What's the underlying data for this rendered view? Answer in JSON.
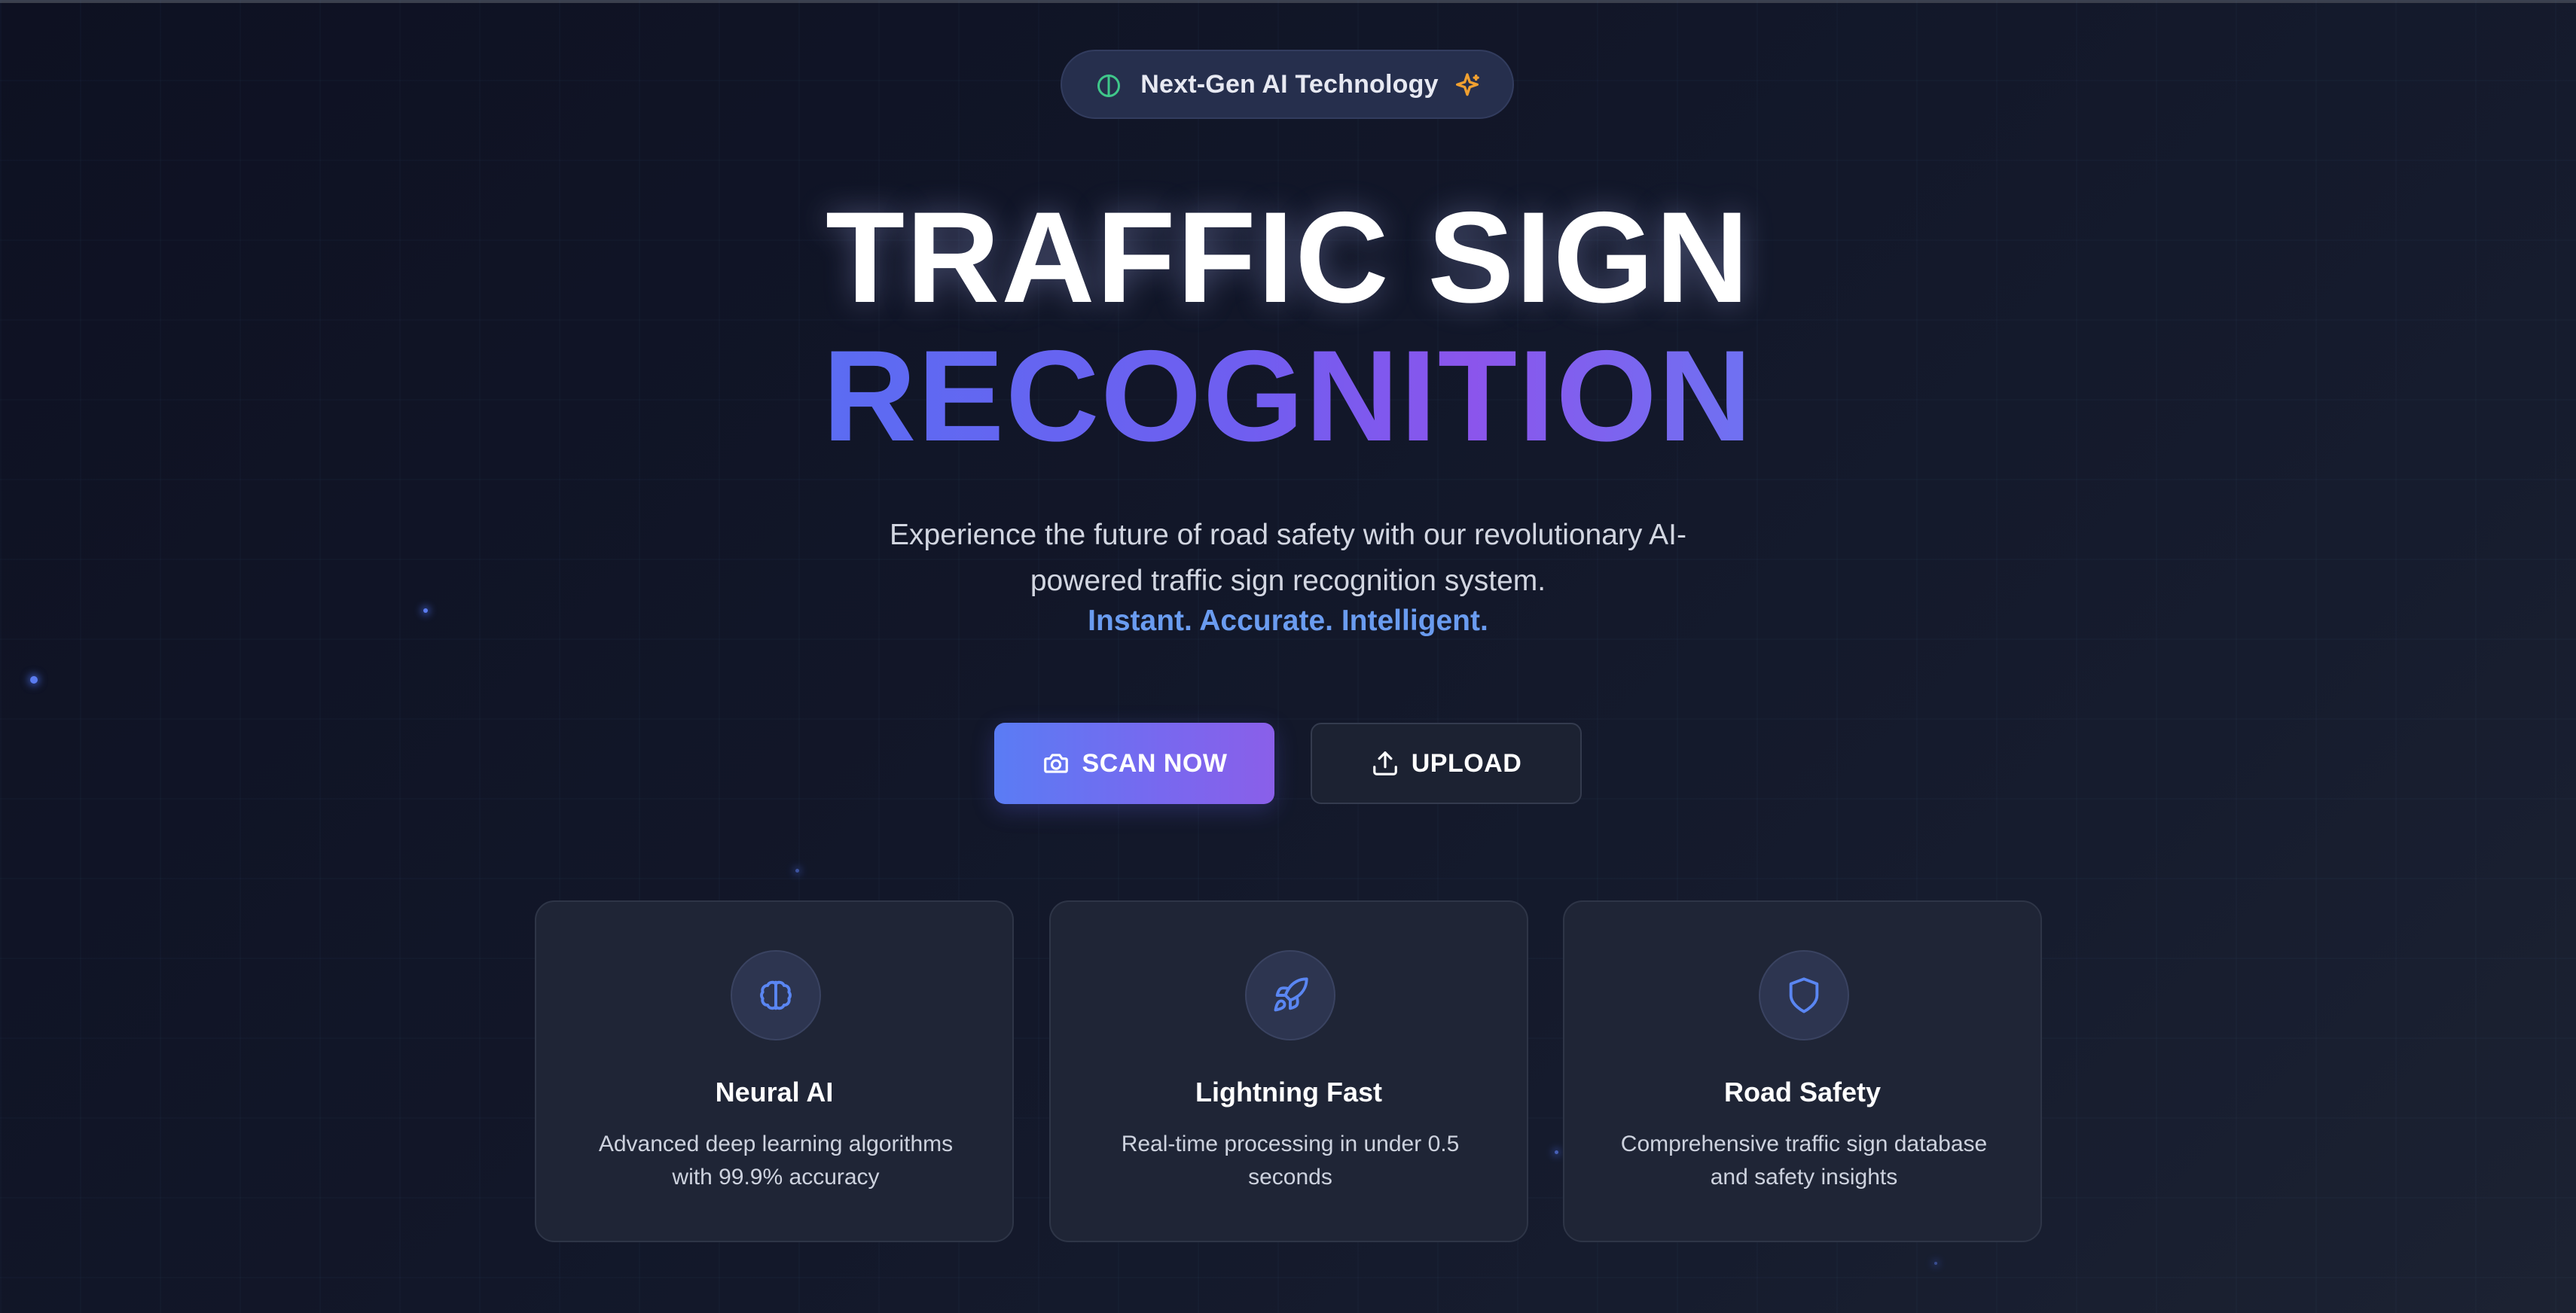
{
  "badge": {
    "label": "Next-Gen AI Technology",
    "left_icon": "brain-icon",
    "right_icon": "sparkle-icon"
  },
  "hero": {
    "title_line1": "TRAFFIC SIGN",
    "title_line2": "RECOGNITION",
    "description": "Experience the future of road safety with our revolutionary AI-powered traffic sign recognition system.",
    "tagline": "Instant. Accurate. Intelligent."
  },
  "actions": {
    "scan": {
      "label": "SCAN NOW",
      "icon": "camera-icon"
    },
    "upload": {
      "label": "UPLOAD",
      "icon": "upload-icon"
    }
  },
  "features": [
    {
      "icon": "brain-icon",
      "title": "Neural AI",
      "description": "Advanced deep learning algorithms with 99.9% accuracy"
    },
    {
      "icon": "rocket-icon",
      "title": "Lightning Fast",
      "description": "Real-time processing in under 0.5 seconds"
    },
    {
      "icon": "shield-icon",
      "title": "Road Safety",
      "description": "Comprehensive traffic sign database and safety insights"
    }
  ],
  "colors": {
    "background": "#121729",
    "accent_blue": "#5a7cf4",
    "accent_purple": "#8a5fe9",
    "tagline": "#6a9cf0",
    "badge_green": "#3fc78a",
    "badge_orange": "#f0a030"
  }
}
